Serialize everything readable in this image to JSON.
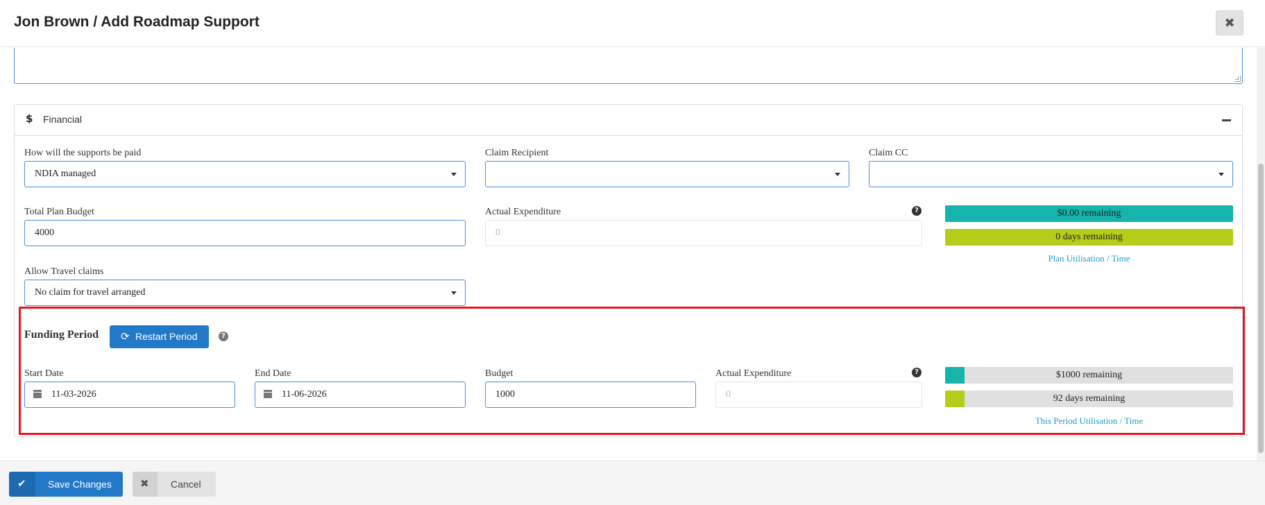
{
  "header": {
    "title": "Jon Brown / Add Roadmap Support",
    "close_icon": "times-icon"
  },
  "financial": {
    "section_title": "Financial",
    "section_icon": "dollar-icon",
    "collapse_icon": "minus-icon",
    "payment": {
      "label": "How will the supports be paid",
      "value": "NDIA managed"
    },
    "claim_recipient": {
      "label": "Claim Recipient",
      "value": ""
    },
    "claim_cc": {
      "label": "Claim CC",
      "value": ""
    },
    "total_budget": {
      "label": "Total Plan Budget",
      "value": "4000"
    },
    "actual_expenditure": {
      "label": "Actual Expenditure",
      "placeholder": "0"
    },
    "plan_money": {
      "text": "$0.00 remaining",
      "fraction": 1.0,
      "color": "#17b3ad"
    },
    "plan_days": {
      "text": "0 days remaining",
      "fraction": 1.0,
      "color": "#b5cc18"
    },
    "plan_caption": "Plan Utilisation / Time",
    "travel": {
      "label": "Allow Travel claims",
      "value": "No claim for travel arranged"
    }
  },
  "funding_period": {
    "title": "Funding Period",
    "restart_label": "Restart Period",
    "restart_icon": "refresh-icon",
    "start_date": {
      "label": "Start Date",
      "value": "11-03-2026"
    },
    "end_date": {
      "label": "End Date",
      "value": "11-06-2026"
    },
    "budget": {
      "label": "Budget",
      "value": "1000"
    },
    "actual_expenditure": {
      "label": "Actual Expenditure",
      "placeholder": "0"
    },
    "money": {
      "text": "$1000 remaining",
      "fraction": 0.067,
      "color": "#17b3ad"
    },
    "days": {
      "text": "92 days remaining",
      "fraction": 0.067,
      "color": "#b5cc18"
    },
    "caption": "This Period Utilisation / Time"
  },
  "footer": {
    "save_label": "Save Changes",
    "save_icon": "check-icon",
    "cancel_label": "Cancel",
    "cancel_icon": "times-icon"
  }
}
